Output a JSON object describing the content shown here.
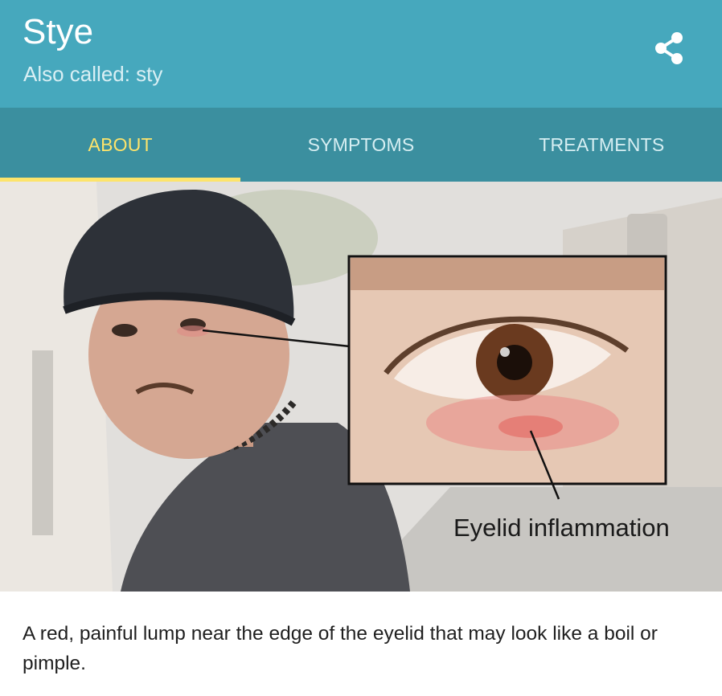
{
  "header": {
    "title": "Stye",
    "subtitle": "Also called: sty",
    "share_icon": "share-icon",
    "background_color": "#46a8bd"
  },
  "tabs": [
    {
      "label": "ABOUT",
      "active": true
    },
    {
      "label": "SYMPTOMS",
      "active": false
    },
    {
      "label": "TREATMENTS",
      "active": false
    }
  ],
  "tab_bar": {
    "background_color": "#3b8f9f",
    "active_color": "#fde46b"
  },
  "image": {
    "callout_label": "Eyelid inflammation"
  },
  "description": "A red, painful lump near the edge of the eyelid that may look like a boil or pimple."
}
